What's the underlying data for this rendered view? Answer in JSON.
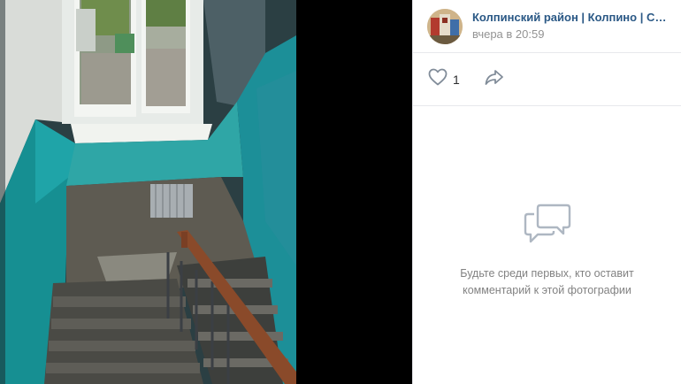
{
  "post": {
    "author_name": "Колпинский район | Колпино | Сан…",
    "time": "вчера в 20:59"
  },
  "actions": {
    "like_count": "1",
    "icons": {
      "like": "heart-icon",
      "share": "share-arrow-icon"
    }
  },
  "comments": {
    "empty_line1": "Будьте среди первых, кто оставит",
    "empty_line2": "комментарий к этой фотографии",
    "icon": "chat-bubbles-icon"
  },
  "colors": {
    "link": "#2a5885",
    "muted": "#828282",
    "wall_teal": "#1fa3a6"
  }
}
